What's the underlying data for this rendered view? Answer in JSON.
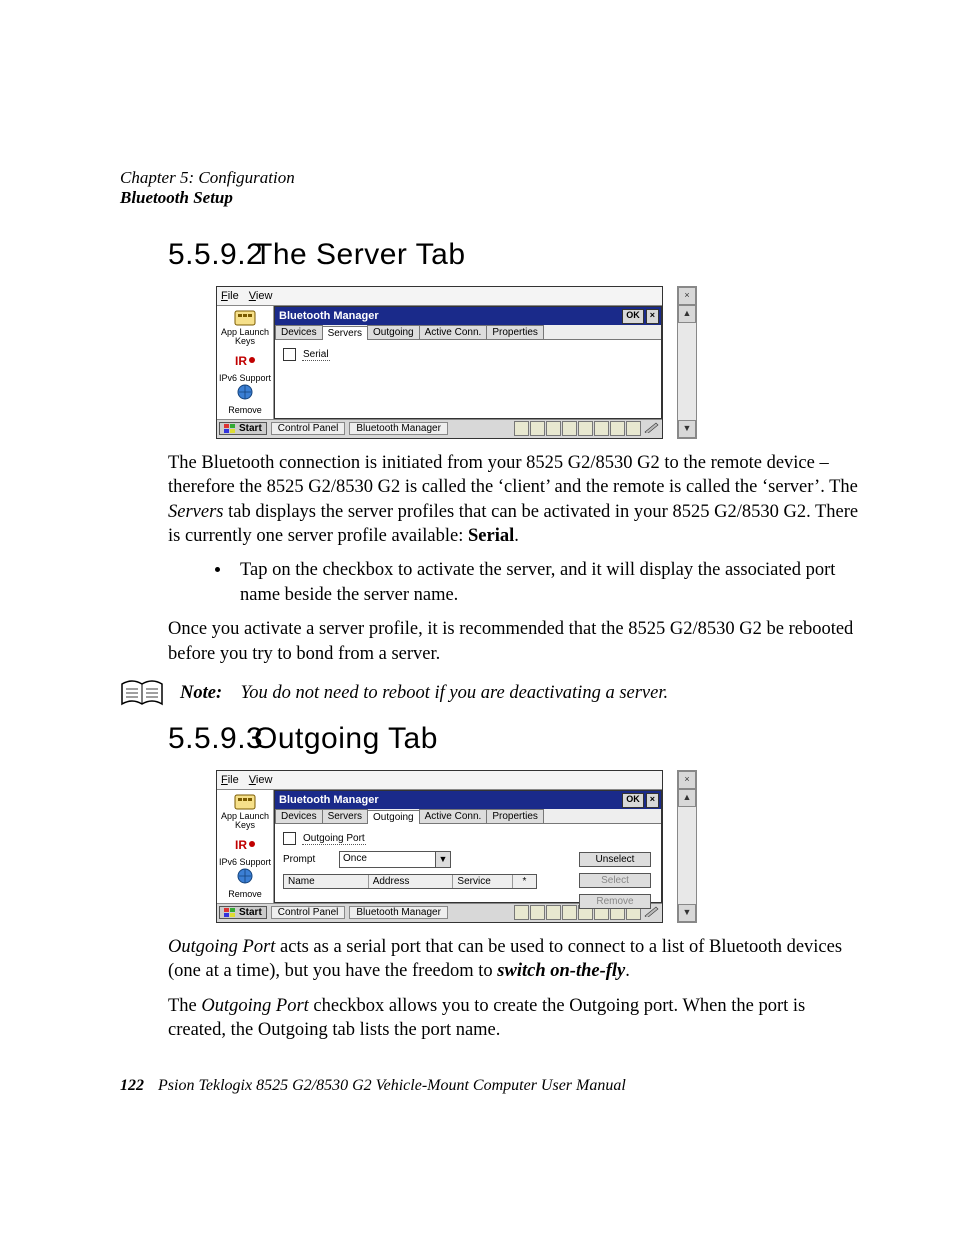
{
  "header": {
    "chapter": "Chapter 5: Configuration",
    "section": "Bluetooth Setup"
  },
  "sections": [
    {
      "number": "5.5.9.2",
      "title": "The Server Tab"
    },
    {
      "number": "5.5.9.3",
      "title": "Outgoing Tab"
    }
  ],
  "shot_common": {
    "menu": {
      "file": "File",
      "view": "View"
    },
    "sidebar": {
      "app_launch": "App Launch Keys",
      "ipv6": "IPv6 Support",
      "remove": "Remove"
    },
    "titlebar": {
      "title": "Bluetooth Manager",
      "ok": "OK",
      "close": "×"
    },
    "tabs": [
      "Devices",
      "Servers",
      "Outgoing",
      "Active Conn.",
      "Properties"
    ],
    "taskbar": {
      "start": "Start",
      "tasks": [
        "Control Panel",
        "Bluetooth Manager"
      ]
    },
    "scrollbar": {
      "up": "▲",
      "down": "▼",
      "close": "×"
    }
  },
  "shot1": {
    "active_tab_index": 1,
    "checkbox_label": "Serial"
  },
  "shot2": {
    "active_tab_index": 2,
    "checkbox_label": "Outgoing Port",
    "prompt_label": "Prompt",
    "prompt_value": "Once",
    "columns": [
      "Name",
      "Address",
      "Service",
      "*"
    ],
    "buttons": {
      "unselect": "Unselect",
      "select": "Select",
      "remove": "Remove"
    }
  },
  "para1_a": "The Bluetooth connection is initiated from your 8525 G2/8530 G2 to the remote device – therefore the 8525 G2/8530 G2 is called the ‘client’ and the remote is called the ‘server’. The ",
  "para1_em": "Servers",
  "para1_b": " tab displays the server profiles that can be activated in your 8525 G2/8530 G2. There is currently one server profile available: ",
  "para1_bold": "Serial",
  "para1_c": ".",
  "bullet1": "Tap on the checkbox to activate the server, and it will display the associated port name beside the server name.",
  "para2": "Once you activate a server profile, it is recommended that the 8525 G2/8530 G2 be rebooted before you try to bond from a server.",
  "note": {
    "label": "Note:",
    "text": "You do not need to reboot if you are deactivating a server."
  },
  "para3_em1": "Outgoing Port",
  "para3_a": " acts as a serial port that can be used to connect to a list of Bluetooth devices (one at a time), but you have the freedom to ",
  "para3_bi": "switch on-the-fly",
  "para3_b": ".",
  "para4_a": "The ",
  "para4_em": "Outgoing Port",
  "para4_b": " checkbox allows you to create the Outgoing port. When the port is created, the Outgoing tab lists the port name.",
  "footer": {
    "page": "122",
    "book": "Psion Teklogix 8525 G2/8530 G2 Vehicle-Mount Computer User Manual"
  }
}
